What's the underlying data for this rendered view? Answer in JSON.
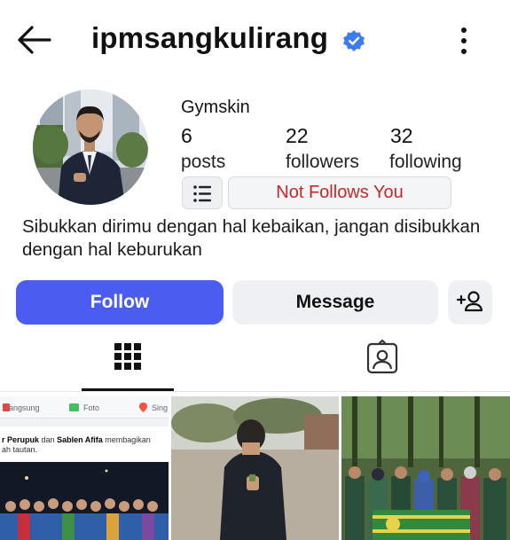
{
  "header": {
    "username": "ipmsangkulirang",
    "back_icon": "arrow-left-icon",
    "verified_icon": "verified-badge-icon",
    "menu_icon": "more-vertical-icon"
  },
  "profile": {
    "display_name": "Gymskin",
    "stats": {
      "posts": {
        "value": "6",
        "label": "posts"
      },
      "followers": {
        "value": "22",
        "label": "followers"
      },
      "following": {
        "value": "32",
        "label": "following"
      }
    },
    "list_icon": "list-icon",
    "relationship": "Not Follows You",
    "bio": "Sibukkan dirimu dengan hal kebaikan, jangan disibukkan dengan hal keburukan"
  },
  "actions": {
    "follow": "Follow",
    "message": "Message",
    "add_icon": "add-person-icon"
  },
  "tabs": [
    {
      "name": "grid",
      "icon": "grid-icon",
      "active": true
    },
    {
      "name": "tagged",
      "icon": "tagged-person-icon",
      "active": false
    }
  ],
  "posts": [
    {
      "fb_bar": {
        "live": "Langsung",
        "photo": "Foto",
        "place": "Sing"
      },
      "fb_names": "r Perupuk",
      "fb_connector": "dan",
      "fb_second": "Sablen Afifa",
      "fb_rest": "membagikan",
      "fb_line2": "ah tautan."
    },
    {},
    {}
  ],
  "colors": {
    "follow_button": "#4a5df0",
    "verified": "#3d7bf0",
    "relationship_text": "#c62828",
    "secondary_button": "#eff0f3"
  }
}
